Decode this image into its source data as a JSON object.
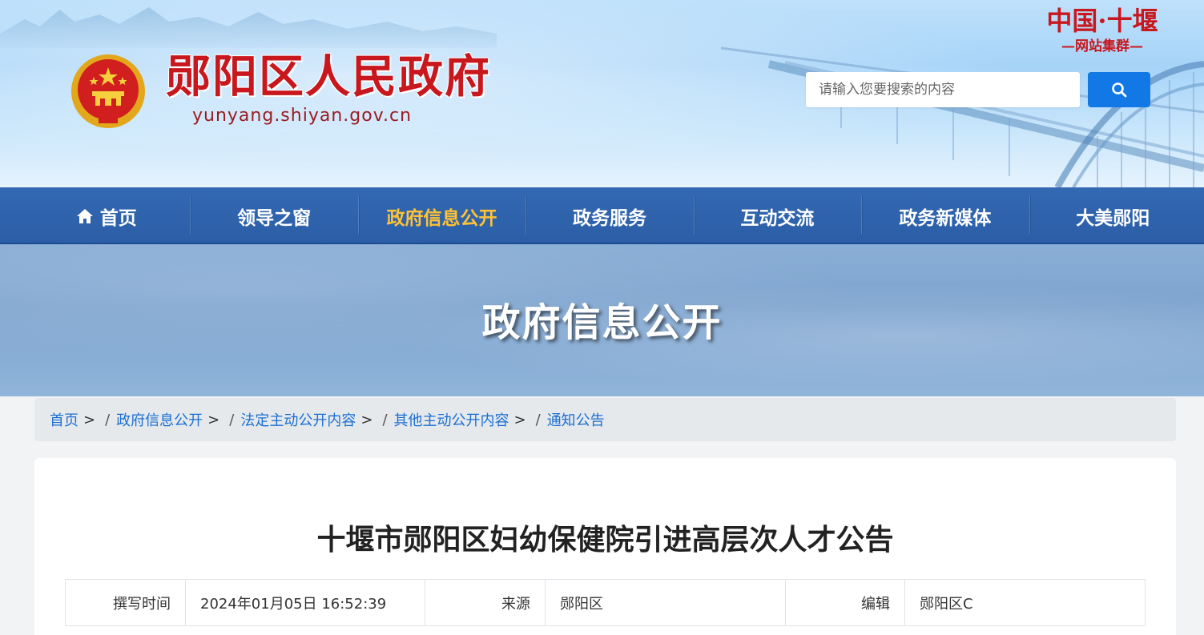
{
  "header": {
    "site_title": "郧阳区人民政府",
    "site_domain": "yunyang.shiyan.gov.cn",
    "group_logo_line1": "中国·十堰",
    "group_logo_line2": "—网站集群—",
    "search_placeholder": "请输入您要搜索的内容",
    "search_icon": "search-icon",
    "accent_color": "#1278e6",
    "brand_color": "#c8171d"
  },
  "nav": {
    "items": [
      {
        "label": "首页",
        "icon": "home-icon"
      },
      {
        "label": "领导之窗"
      },
      {
        "label": "政府信息公开",
        "active": true
      },
      {
        "label": "政务服务"
      },
      {
        "label": "互动交流"
      },
      {
        "label": "政务新媒体"
      },
      {
        "label": "大美郧阳"
      }
    ],
    "active_color": "#ffc233"
  },
  "banner": {
    "title": "政府信息公开"
  },
  "breadcrumb": {
    "items": [
      "首页",
      "政府信息公开",
      "法定主动公开内容",
      "其他主动公开内容",
      "通知公告"
    ],
    "separator": ">"
  },
  "article": {
    "title": "十堰市郧阳区妇幼保健院引进高层次人才公告",
    "meta": {
      "time_label": "撰写时间",
      "time_value": "2024年01月05日 16:52:39",
      "source_label": "来源",
      "source_value": "郧阳区",
      "editor_label": "编辑",
      "editor_value": "郧阳区C"
    }
  }
}
